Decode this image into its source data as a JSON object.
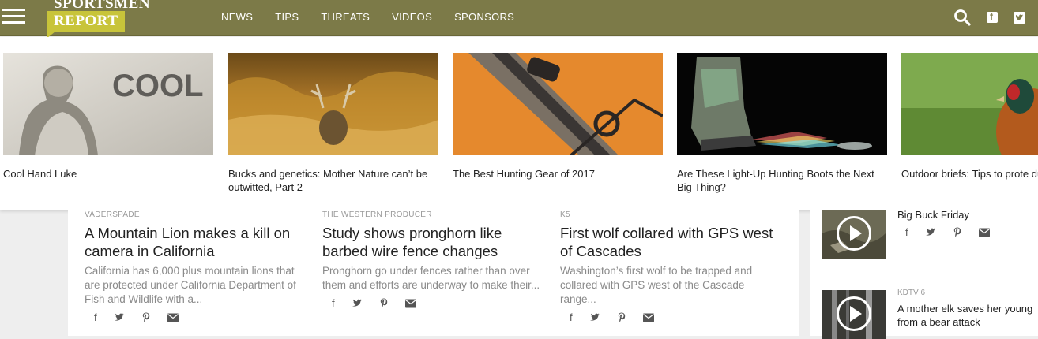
{
  "brand": {
    "line1": "SPORTSMEN",
    "line2": "REPORT"
  },
  "nav": [
    "NEWS",
    "TIPS",
    "THREATS",
    "VIDEOS",
    "SPONSORS"
  ],
  "featured": [
    {
      "title": "Cool Hand Luke",
      "img_text": "COOL HAND LUKE"
    },
    {
      "title": "Bucks and genetics: Mother Nature can’t be outwitted, Part 2"
    },
    {
      "title": "The Best Hunting Gear of 2017"
    },
    {
      "title": "Are These Light-Up Hunting Boots the Next Big Thing?"
    },
    {
      "title": "Outdoor briefs: Tips to prote during haying season"
    }
  ],
  "articles": [
    {
      "source": "VADERSPADE",
      "title": "A Mountain Lion makes a kill on camera in California",
      "excerpt": "California has 6,000 plus mountain lions that are protected under California Department of Fish and Wildlife with a..."
    },
    {
      "source": "THE WESTERN PRODUCER",
      "title": "Study shows pronghorn like barbed wire fence changes",
      "excerpt": "Pronghorn go under fences rather than over them and efforts are underway to make their..."
    },
    {
      "source": "K5",
      "title": "First wolf collared with GPS west of Cascades",
      "excerpt": "Washington’s first wolf to be trapped and collared with GPS west of the Cascade range..."
    }
  ],
  "sidebar": [
    {
      "source": "",
      "title": "Big Buck Friday"
    },
    {
      "source": "KDTV 6",
      "title": "A mother elk saves her young from a bear attack"
    }
  ],
  "share_icons": [
    "facebook-icon",
    "twitter-icon",
    "pinterest-icon",
    "email-icon"
  ],
  "colors": {
    "header": "#7c7a48",
    "logo_tag": "#c8c43a"
  }
}
